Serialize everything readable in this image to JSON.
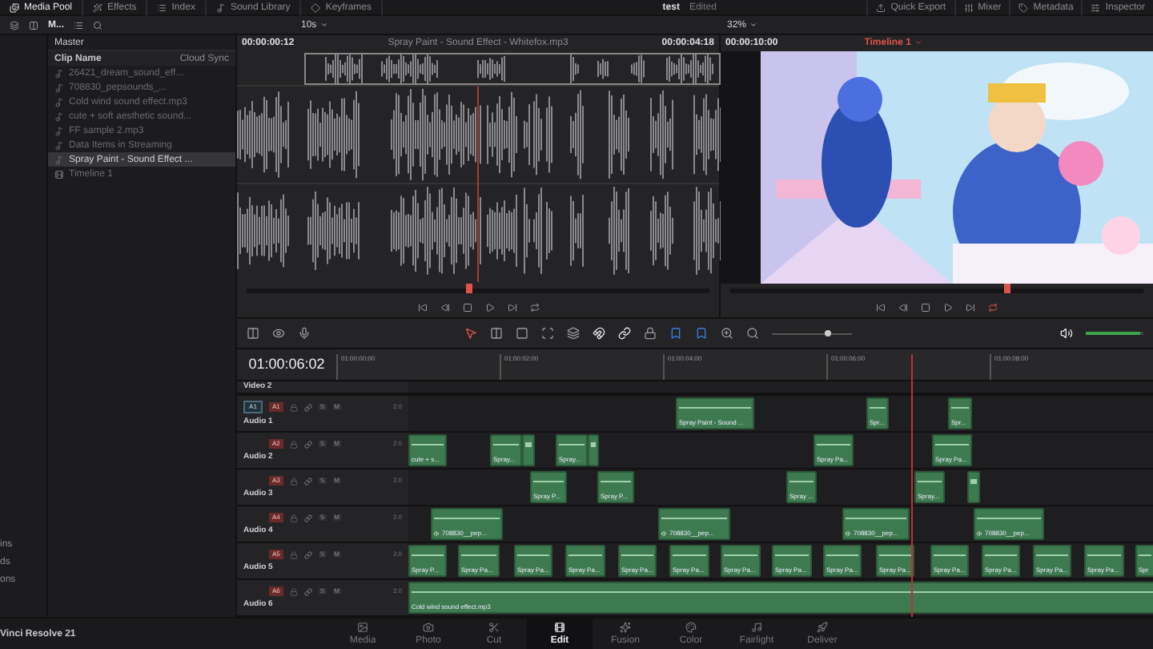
{
  "top_bar": {
    "left_tabs": [
      {
        "label": "Media Pool",
        "selected": true
      },
      {
        "label": "Effects",
        "selected": false
      },
      {
        "label": "Index",
        "selected": false
      },
      {
        "label": "Sound Library",
        "selected": false
      },
      {
        "label": "Keyframes",
        "selected": false
      }
    ],
    "project_title": "test",
    "project_status": "Edited",
    "right_tabs": [
      {
        "label": "Quick Export",
        "selected": false
      },
      {
        "label": "Mixer",
        "selected": false
      },
      {
        "label": "Metadata",
        "selected": false
      },
      {
        "label": "Inspector",
        "selected": false
      }
    ]
  },
  "toolbar": {
    "bin_label": "M...",
    "zoom": "10s",
    "viewer_zoom": "32%"
  },
  "bins": {
    "items": [
      "ins",
      "ds",
      "ons"
    ]
  },
  "media_pool": {
    "header": "Master",
    "columns": [
      "Clip Name",
      "Cloud Sync"
    ],
    "clips": [
      {
        "name": "26421_dream_sound_eff...",
        "selected": false
      },
      {
        "name": "708830_pepsounds_...",
        "selected": false
      },
      {
        "name": "Cold wind sound effect.mp3",
        "selected": false
      },
      {
        "name": "cute + soft aesthetic sound...",
        "selected": false
      },
      {
        "name": "FF sample 2.mp3",
        "selected": false
      },
      {
        "name": "Data Items in Streaming",
        "selected": false
      },
      {
        "name": "Spray Paint - Sound Effect ...",
        "selected": true
      },
      {
        "name": "Timeline 1",
        "selected": false
      }
    ]
  },
  "source_viewer": {
    "timecode": "00:00:00:12",
    "title": "Spray Paint - Sound Effect - Whitefox.mp3",
    "duration": "00:00:04:18",
    "scrubber": {
      "level": 0.48
    }
  },
  "timeline_viewer": {
    "duration": "00:00:10:00",
    "timeline": "Timeline 1",
    "scrubber": {
      "level": 0.67
    }
  },
  "edit_toolbar": {
    "zoom_slider": {
      "level": 0.7
    },
    "volume": {
      "level": 0.95
    }
  },
  "timeline": {
    "timecode": "01:00:06:02",
    "ruler": [
      "01:00:00:00",
      "01:00:02:00",
      "01:00:04:00",
      "01:00:06:00",
      "01:00:08:00"
    ],
    "video_track": "Video 2",
    "tracks": [
      {
        "name": "Audio 1",
        "source_patch": "A1",
        "id": "A1",
        "solo": "S",
        "mute": "M",
        "format": "2.0",
        "clips": [
          {
            "label": "Spray Paint - Sound ..."
          },
          {
            "label": "Spr..."
          },
          {
            "label": "Spr..."
          }
        ]
      },
      {
        "name": "Audio 2",
        "id": "A2",
        "solo": "S",
        "mute": "M",
        "format": "2.0",
        "clips": [
          {
            "label": "cute + s..."
          },
          {
            "label": "Spray..."
          },
          {
            "kind": "sliver"
          },
          {
            "label": "Spray..."
          },
          {
            "kind": "sliver"
          },
          {
            "label": "Spray Pa..."
          },
          {
            "label": "Spray Pa..."
          }
        ]
      },
      {
        "name": "Audio 3",
        "id": "A3",
        "solo": "S",
        "mute": "M",
        "format": "2.0",
        "clips": [
          {
            "label": "Spray P..."
          },
          {
            "label": "Spray P..."
          },
          {
            "label": "Spray ..."
          },
          {
            "label": "Spray..."
          },
          {
            "kind": "sliver"
          }
        ]
      },
      {
        "name": "Audio 4",
        "id": "A4",
        "solo": "S",
        "mute": "M",
        "format": "2.0",
        "clips": [
          {
            "label": "708830__pep..."
          },
          {
            "label": "708830__pep..."
          },
          {
            "label": "708830__pep..."
          },
          {
            "label": "708830__pep..."
          }
        ]
      },
      {
        "name": "Audio 5",
        "id": "A5",
        "solo": "S",
        "mute": "M",
        "format": "2.0",
        "clips": [
          {
            "label": "Spray P..."
          },
          {
            "label": "Spray Pa..."
          },
          {
            "label": "Spray Pa..."
          },
          {
            "label": "Spray Pa..."
          },
          {
            "label": "Spray Pa..."
          },
          {
            "label": "Spray Pa..."
          },
          {
            "label": "Spray Pa..."
          },
          {
            "label": "Spray Pa..."
          },
          {
            "label": "Spray Pa..."
          },
          {
            "label": "Spray Pa..."
          },
          {
            "label": "Spray Pa..."
          },
          {
            "label": "Spray Pa..."
          },
          {
            "label": "Spray Pa..."
          },
          {
            "label": "Spray Pa..."
          },
          {
            "label": "Spr"
          }
        ]
      },
      {
        "name": "Audio 6",
        "id": "A6",
        "solo": "S",
        "mute": "M",
        "format": "2.0",
        "clips": [
          {
            "label": "Cold wind sound effect.mp3"
          }
        ]
      }
    ]
  },
  "app_name": "Vinci Resolve 21",
  "pages": [
    {
      "label": "Media",
      "selected": false
    },
    {
      "label": "Photo",
      "selected": false
    },
    {
      "label": "Cut",
      "selected": false
    },
    {
      "label": "Edit",
      "selected": true
    },
    {
      "label": "Fusion",
      "selected": false
    },
    {
      "label": "Color",
      "selected": false
    },
    {
      "label": "Fairlight",
      "selected": false
    },
    {
      "label": "Deliver",
      "selected": false
    }
  ]
}
